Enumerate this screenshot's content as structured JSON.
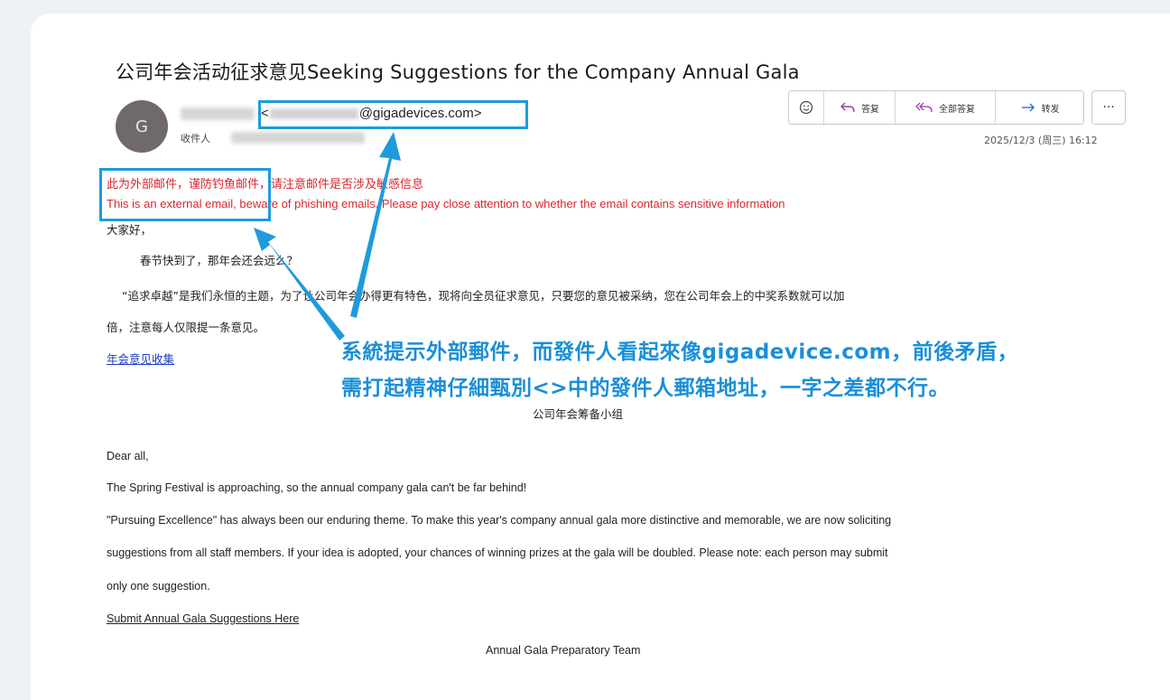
{
  "email": {
    "subject": "公司年会活动征求意见Seeking Suggestions for the Company Annual Gala",
    "avatar_initial": "G",
    "sender_open": "<",
    "sender_domain": "@gigadevices.com>",
    "recipient_label": "收件人",
    "date": "2025/12/3 (周三) 16:12"
  },
  "toolbar": {
    "emoji_icon": "smiley-icon",
    "reply_label": "答复",
    "reply_all_label": "全部答复",
    "forward_label": "转发",
    "more_label": "···"
  },
  "warning": {
    "cn": "此为外部邮件，谨防钓鱼邮件，请注意邮件是否涉及敏感信息",
    "en": "This is an external email, beware of phishing emails. Please pay close attention to whether the email contains sensitive information"
  },
  "body_cn": {
    "greeting": "大家好，",
    "line1": "春节快到了，那年会还会远么？",
    "line2": "“追求卓越”是我们永恒的主题，为了让公司年会办得更有特色，现将向全员征求意见，只要您的意见被采纳，您在公司年会上的中奖系数就可以加",
    "line3": "倍，注意每人仅限提一条意见。",
    "link": "年会意见收集",
    "signature": "公司年会筹备小组"
  },
  "body_en": {
    "greeting": "Dear all,",
    "line1": "The Spring Festival is approaching, so the annual company gala can't be far behind!",
    "line2": "\"Pursuing Excellence\" has always been our enduring theme. To make this year's company annual gala more distinctive and memorable, we are now soliciting",
    "line3": "suggestions from all staff members. If your idea is adopted, your chances of winning prizes at the gala will be doubled. Please note: each person may submit",
    "line4": "only one suggestion.",
    "link": "Submit Annual Gala Suggestions Here",
    "signature": "Annual Gala Preparatory Team"
  },
  "annotation": {
    "line1": "系統提示外部郵件，而發件人看起來像gigadevice.com，前後矛盾，",
    "line2": "需打起精神仔細甄別<>中的發件人郵箱地址，一字之差都不行。"
  },
  "colors": {
    "annotation": "#1a8fd8",
    "warning": "#d9272e",
    "link": "#1d3fbf"
  }
}
